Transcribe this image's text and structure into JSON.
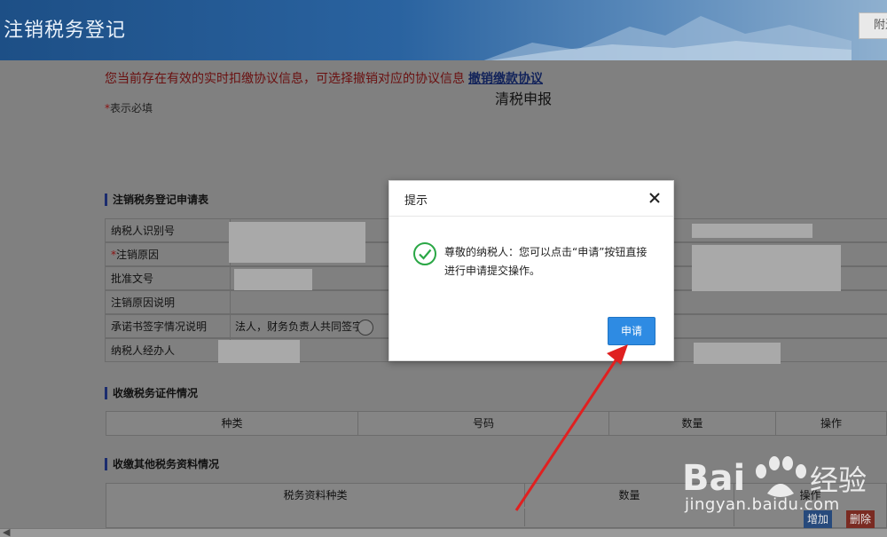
{
  "header": {
    "title": "注销税务登记",
    "top_button": "附近"
  },
  "page": {
    "title": "清税申报",
    "notice": "您当前存在有效的实时扣缴协议信息，可选择撤销对应的协议信息",
    "notice_link": "撤销缴款协议",
    "required_star": "*",
    "required_text": "表示必填"
  },
  "form": {
    "section_title": "注销税务登记申请表",
    "rows": [
      {
        "star": "",
        "label": "纳税人识别号"
      },
      {
        "star": "*",
        "label": "注销原因"
      },
      {
        "star": "",
        "label": "批准文号"
      },
      {
        "star": "",
        "label": "注销原因说明"
      },
      {
        "star": "",
        "label": "承诺书签字情况说明"
      },
      {
        "star": "",
        "label": "纳税人经办人"
      }
    ],
    "signature_option": "法人，财务负责人共同签字"
  },
  "certificates": {
    "section_title": "收缴税务证件情况",
    "columns": [
      "种类",
      "号码",
      "数量",
      "操作"
    ]
  },
  "other_materials": {
    "section_title": "收缴其他税务资料情况",
    "columns": [
      "税务资料种类",
      "数量",
      "操作"
    ],
    "add_button": "增加",
    "delete_button": "删除"
  },
  "modal": {
    "title": "提示",
    "message": "尊敬的纳税人：您可以点击“申请”按钮直接进行申请提交操作。",
    "button": "申请"
  },
  "watermark": {
    "brand": "Bai",
    "brand_suffix": "经验",
    "url": "jingyan.baidu.com"
  },
  "colors": {
    "header": "#1d4f86",
    "notice": "#6a0f0f",
    "primary_button": "#2e8be3",
    "success_icon": "#2aa745",
    "arrow": "#e02020"
  }
}
